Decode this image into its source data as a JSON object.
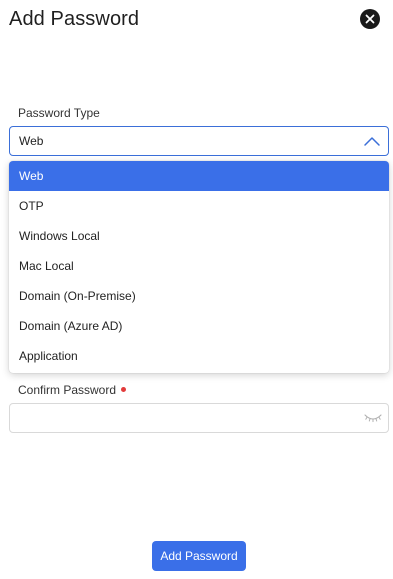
{
  "dialog": {
    "title": "Add Password"
  },
  "password_type": {
    "label": "Password Type",
    "selected": "Web",
    "options": [
      "Web",
      "OTP",
      "Windows Local",
      "Mac Local",
      "Domain (On-Premise)",
      "Domain (Azure AD)",
      "Application"
    ]
  },
  "confirm_password": {
    "label": "Confirm Password",
    "value": "",
    "required": true
  },
  "submit": {
    "label": "Add Password"
  },
  "colors": {
    "accent": "#3a6fe8",
    "required": "#e23b3b"
  },
  "icons": {
    "close": "close-circle-icon",
    "chevron": "chevron-up-icon",
    "eye": "eye-closed-icon"
  }
}
